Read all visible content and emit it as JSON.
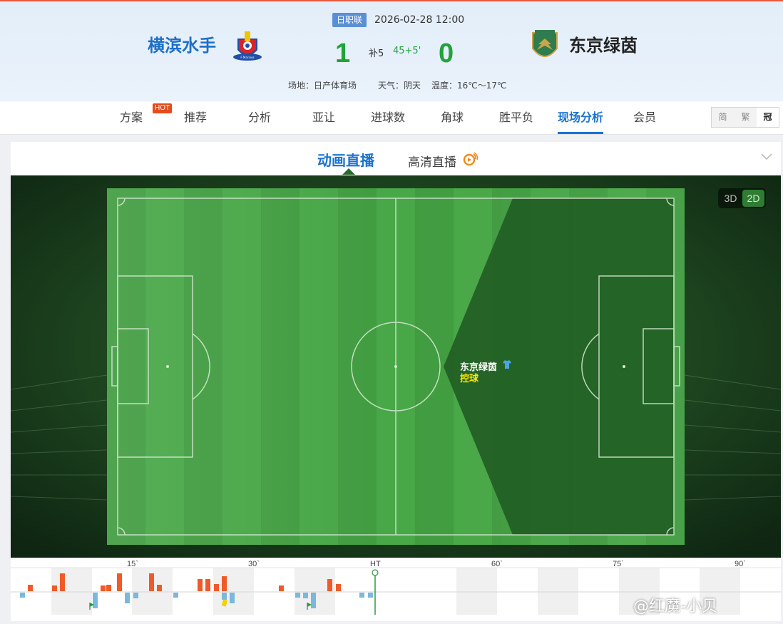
{
  "match": {
    "league": "日职联",
    "datetime": "2026-02-28 12:00",
    "home_team": "横滨水手",
    "away_team": "东京绿茵",
    "home_score": "1",
    "away_score": "0",
    "extra_time": "补5",
    "minute": "45+5'",
    "venue": "场地：日产体育场",
    "weather": "天气：阴天",
    "temperature": "温度：16℃～17℃"
  },
  "nav": {
    "items": [
      "方案",
      "推荐",
      "分析",
      "亚让",
      "进球数",
      "角球",
      "胜平负",
      "现场分析",
      "会员"
    ],
    "active": "现场分析",
    "hot_badge": "HOT",
    "lang": [
      "简",
      "繁",
      "冠"
    ]
  },
  "live": {
    "tab_animation": "动画直播",
    "tab_hd": "高清直播",
    "view_3d": "3D",
    "view_2d": "2D",
    "possession_team": "东京绿茵",
    "possession_status": "控球"
  },
  "timeline": {
    "ticks": [
      "15`",
      "30`",
      "HT",
      "60`",
      "75`",
      "90`"
    ],
    "marker": "HT"
  },
  "watermark": "@红魔-小贝",
  "colors": {
    "accent": "#1a73d1",
    "score_green": "#22a33a",
    "home_bar": "#f05a28",
    "away_bar": "#7bb8dc"
  }
}
